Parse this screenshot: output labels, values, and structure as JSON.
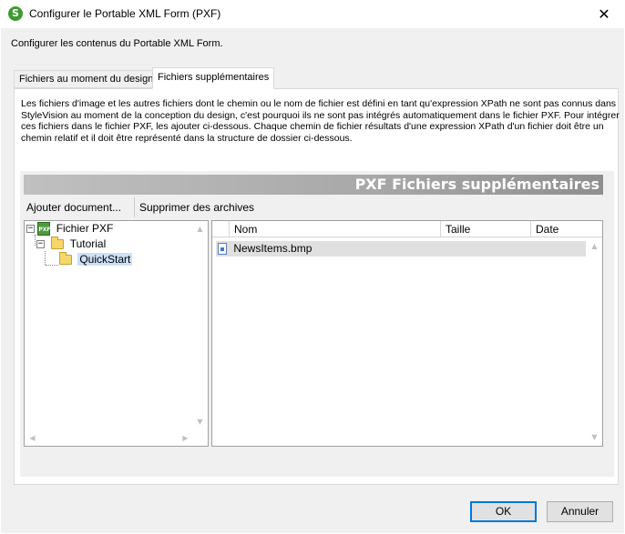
{
  "window": {
    "title": "Configurer le Portable XML Form (PXF)",
    "icon": "altova-green-icon",
    "close_glyph": "✕"
  },
  "dialog": {
    "subtitle": "Configurer les contenus du Portable XML Form."
  },
  "tabs": [
    {
      "label": "Fichiers au moment du design",
      "active": false
    },
    {
      "label": "Fichiers supplémentaires",
      "active": true
    }
  ],
  "panel": {
    "description": "Les fichiers d'image et les autres fichiers dont le chemin ou le nom de fichier est défini en tant qu'expression XPath ne sont pas connus dans StyleVision au moment de la conception du design, c'est pourquoi ils ne sont pas intégrés automatiquement dans le fichier PXF. Pour intégrer ces fichiers dans le fichier PXF, les ajouter ci-dessous. Chaque chemin de fichier résultats d'une expression XPath d'un fichier doit être un chemin relatif et il doit être représenté dans la structure de dossier ci-dessous.",
    "banner": "PXF Fichiers supplémentaires",
    "actions": {
      "add": "Ajouter document...",
      "remove": "Supprimer des archives"
    }
  },
  "tree": {
    "root": {
      "label": "Fichier PXF",
      "expander": "−",
      "icon": "pxf-file-icon",
      "icon_text": "PXF"
    },
    "child": {
      "label": "Tutorial",
      "expander": "−",
      "icon": "folder-icon"
    },
    "grandchild": {
      "label": "QuickStart",
      "icon": "folder-icon",
      "selected": true
    }
  },
  "file_list": {
    "columns": [
      "Nom",
      "Taille",
      "Date"
    ],
    "rows": [
      {
        "name": "NewsItems.bmp",
        "size": "",
        "date": "",
        "icon": "bmp-file-icon"
      }
    ]
  },
  "scroll": {
    "up": "▲",
    "down": "▼",
    "left": "◀",
    "right": "▶"
  },
  "buttons": {
    "ok": "OK",
    "cancel": "Annuler"
  }
}
